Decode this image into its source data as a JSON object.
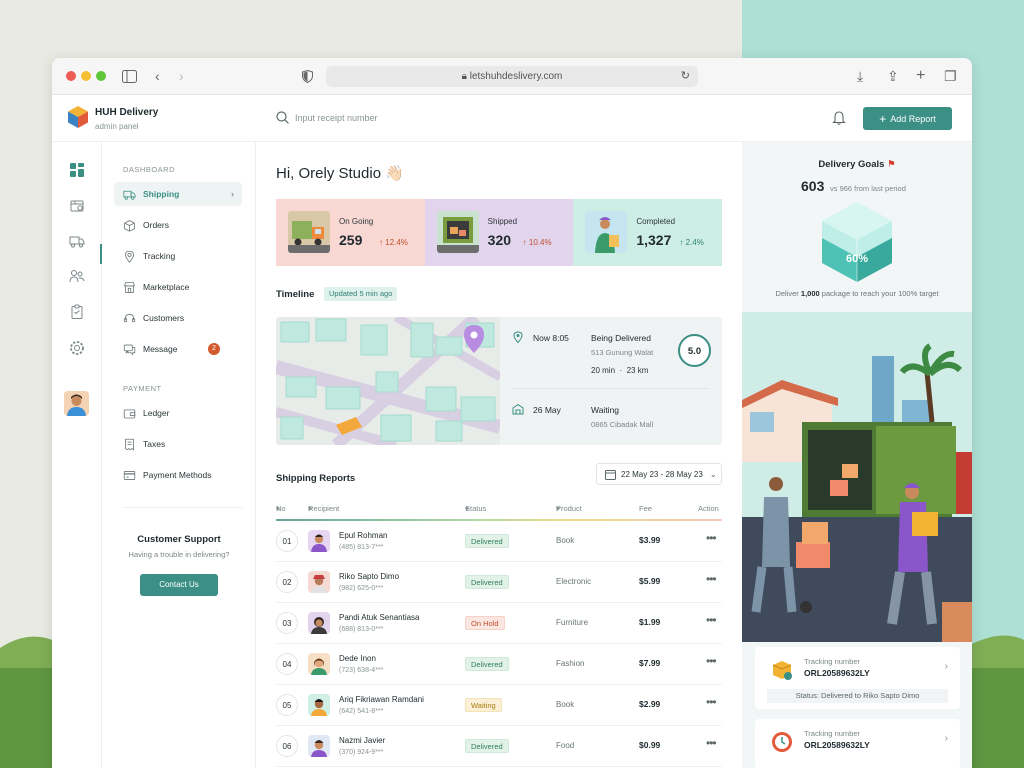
{
  "browser": {
    "url": "letshuhdeslivery.com"
  },
  "app": {
    "name": "HUH Delivery",
    "subtitle": "admin panel"
  },
  "header": {
    "search_placeholder": "Input receipt number",
    "add_report_label": "Add Report"
  },
  "nav": {
    "section_dashboard": "DASHBOARD",
    "section_payment": "PAYMENT",
    "items": [
      {
        "label": "Shipping",
        "icon": "truck-icon",
        "active": true
      },
      {
        "label": "Orders",
        "icon": "box-icon"
      },
      {
        "label": "Tracking",
        "icon": "map-pin-icon"
      },
      {
        "label": "Marketplace",
        "icon": "store-icon"
      },
      {
        "label": "Customers",
        "icon": "headset-icon"
      },
      {
        "label": "Message",
        "icon": "chat-icon",
        "badge": "2"
      }
    ],
    "payment_items": [
      {
        "label": "Ledger",
        "icon": "wallet-icon"
      },
      {
        "label": "Taxes",
        "icon": "receipt-icon"
      },
      {
        "label": "Payment Methods",
        "icon": "card-icon"
      }
    ],
    "support": {
      "title": "Customer Support",
      "subtitle": "Having a trouble in delivering?",
      "button": "Contact Us"
    }
  },
  "main": {
    "greeting": "Hi, Orely Studio 👋🏻",
    "stats": [
      {
        "label": "On Going",
        "value": "259",
        "change": "12.4%",
        "direction": "up",
        "bg": "#f9d8d3"
      },
      {
        "label": "Shipped",
        "value": "320",
        "change": "10.4%",
        "direction": "up",
        "bg": "#e3d4ee"
      },
      {
        "label": "Completed",
        "value": "1,327",
        "change": "2.4%",
        "direction": "up",
        "bg": "#cdeee4"
      }
    ],
    "timeline": {
      "title": "Timeline",
      "updated": "Updated 5 min ago",
      "events": [
        {
          "time": "Now 8:05",
          "status": "Being Delivered",
          "address": "513 Gunung Walat",
          "duration": "20 min",
          "distance": "23 km"
        },
        {
          "time": "26 May",
          "status": "Waiting",
          "address": "0865 Cibadak Mall"
        }
      ],
      "score": "5.0"
    },
    "reports": {
      "title": "Shipping Reports",
      "date_range": "22 May 23 - 28 May 23",
      "columns": [
        "No",
        "Recipient",
        "Status",
        "Product",
        "Fee",
        "Action"
      ],
      "rows": [
        {
          "no": "01",
          "name": "Epul Rohman",
          "phone": "(485) 813-7***",
          "status": "Delivered",
          "product": "Book",
          "fee": "$3.99"
        },
        {
          "no": "02",
          "name": "Riko Sapto Dimo",
          "phone": "(982) 625-0***",
          "status": "Delivered",
          "product": "Electronic",
          "fee": "$5.99"
        },
        {
          "no": "03",
          "name": "Pandi Atuk Senantiasa",
          "phone": "(688) 813-0***",
          "status": "On Hold",
          "product": "Furniture",
          "fee": "$1.99"
        },
        {
          "no": "04",
          "name": "Dede Inon",
          "phone": "(723) 638-4***",
          "status": "Delivered",
          "product": "Fashion",
          "fee": "$7.99"
        },
        {
          "no": "05",
          "name": "Ariq Fikriawan Ramdani",
          "phone": "(642) 541-8***",
          "status": "Waiting",
          "product": "Book",
          "fee": "$2.99"
        },
        {
          "no": "06",
          "name": "Nazmi Javier",
          "phone": "(370) 924-9***",
          "status": "Delivered",
          "product": "Food",
          "fee": "$0.99"
        }
      ]
    }
  },
  "goals": {
    "title": "Delivery Goals",
    "value": "603",
    "comparison": "vs 966 from last period",
    "percent": "60%",
    "footer_prefix": "Deliver",
    "footer_amount": "1,000",
    "footer_suffix": "package to reach your 100% target"
  },
  "tracking": [
    {
      "label": "Tracking number",
      "number": "ORL20589632LY",
      "status": "Status: Delivered to Riko Sapto Dimo"
    },
    {
      "label": "Tracking number",
      "number": "ORL20589632LY"
    }
  ],
  "colors": {
    "accent": "#3b8f84",
    "badge": "#d25a2c"
  }
}
